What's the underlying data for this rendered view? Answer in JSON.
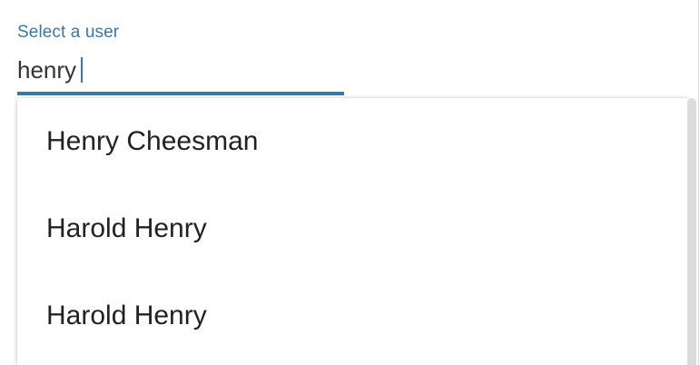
{
  "field": {
    "label": "Select a user",
    "value": "henry",
    "accent_color": "#3b78a6"
  },
  "options": [
    {
      "label": "Henry Cheesman"
    },
    {
      "label": "Harold Henry"
    },
    {
      "label": "Harold Henry"
    }
  ]
}
